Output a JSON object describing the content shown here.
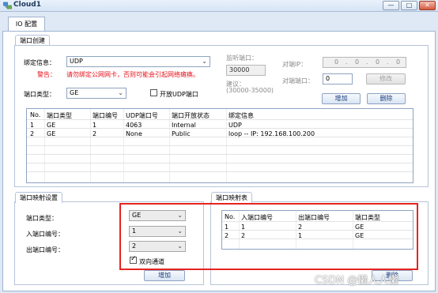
{
  "window": {
    "title": "Cloud1",
    "controls": {
      "minimize": "—",
      "maximize": "□",
      "close": "✕"
    }
  },
  "tabs": [
    {
      "label": "IO 配置"
    }
  ],
  "port_create": {
    "section_label": "端口创建",
    "bind_info_label": "绑定信息：",
    "bind_info_value": "UDP",
    "warning_label": "警告：",
    "warning_text": "请勿绑定公网网卡，否则可能会引起网络瘫痪。",
    "port_type_label": "端口类型：",
    "port_type_value": "GE",
    "open_udp_label": "开放UDP端口",
    "listen_port_label": "监听端口：",
    "listen_port_value": "30000",
    "suggest_label": "建议：",
    "suggest_range": "(30000-35000)",
    "peer_ip_label": "对端IP：",
    "peer_ip_octets": [
      "0",
      "0",
      "0",
      "0"
    ],
    "peer_port_label": "对端端口：",
    "peer_port_value": "0",
    "modify_button": "修改",
    "add_button": "增加",
    "delete_button": "删除"
  },
  "port_table": {
    "headers": [
      "No.",
      "端口类型",
      "端口编号",
      "UDP端口号",
      "端口开放状态",
      "绑定信息"
    ],
    "rows": [
      [
        "1",
        "GE",
        "1",
        "4063",
        "Internal",
        "UDP"
      ],
      [
        "2",
        "GE",
        "2",
        "None",
        "Public",
        "loop -- IP: 192.168.100.200"
      ]
    ]
  },
  "mapping_settings": {
    "section_label": "端口映射设置",
    "port_type_label": "端口类型：",
    "port_type_value": "GE",
    "in_port_label": "入端口编号：",
    "in_port_value": "1",
    "out_port_label": "出端口编号：",
    "out_port_value": "2",
    "bidirectional_label": "双向通道",
    "bidirectional_checked": true,
    "add_button": "增加"
  },
  "mapping_table": {
    "section_label": "端口映射表",
    "headers": [
      "No.",
      "入端口编号",
      "出端口编号",
      "端口类型"
    ],
    "rows": [
      [
        "1",
        "1",
        "2",
        "GE"
      ],
      [
        "2",
        "2",
        "1",
        "GE"
      ]
    ],
    "delete_button": "删除"
  },
  "watermark": "CSDN @懒人人懒",
  "colors": {
    "highlight_border": "#e52420",
    "warning_text": "#e8101a",
    "title_text": "#1e395b"
  }
}
